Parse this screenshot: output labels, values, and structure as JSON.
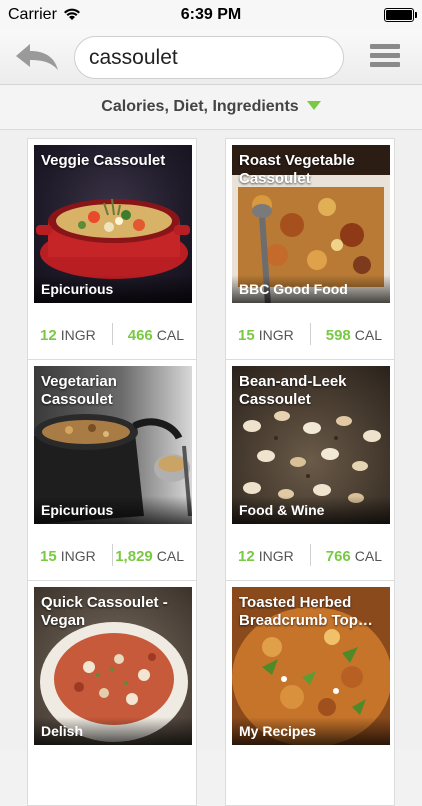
{
  "status": {
    "carrier": "Carrier",
    "time": "6:39 PM"
  },
  "search": {
    "query": "cassoulet"
  },
  "filter": {
    "label": "Calories, Diet, Ingredients"
  },
  "colors": {
    "accent": "#7ac943"
  },
  "recipes": [
    {
      "title": "Veggie Cassoulet",
      "source": "Epicurious",
      "ingr": "12",
      "ingr_label": "INGR",
      "cal": "466",
      "cal_label": "CAL"
    },
    {
      "title": "Roast Vegetable Cassoulet",
      "source": "BBC Good Food",
      "ingr": "15",
      "ingr_label": "INGR",
      "cal": "598",
      "cal_label": "CAL"
    },
    {
      "title": "Vegetarian Cassoulet",
      "source": "Epicurious",
      "ingr": "15",
      "ingr_label": "INGR",
      "cal": "1,829",
      "cal_label": "CAL"
    },
    {
      "title": "Bean-and-Leek Cassoulet",
      "source": "Food & Wine",
      "ingr": "12",
      "ingr_label": "INGR",
      "cal": "766",
      "cal_label": "CAL"
    },
    {
      "title": "Quick Cassoulet - Vegan",
      "source": "Delish"
    },
    {
      "title": "Toasted Herbed Breadcrumb Top…",
      "source": "My Recipes"
    }
  ]
}
